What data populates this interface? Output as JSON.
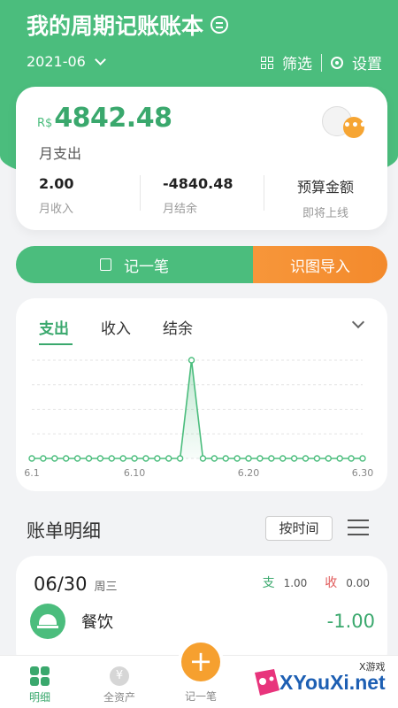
{
  "header": {
    "title": "我的周期记账账本",
    "month": "2021-06",
    "filter_label": "筛选",
    "settings_label": "设置"
  },
  "summary": {
    "currency": "R$",
    "amount": "4842.48",
    "amount_label": "月支出",
    "income_value": "2.00",
    "income_label": "月收入",
    "balance_value": "-4840.48",
    "balance_label": "月结余",
    "budget_value": "预算金额",
    "budget_label": "即将上线",
    "more_label": "•••"
  },
  "actions": {
    "record_label": "记一笔",
    "import_label": "识图导入"
  },
  "chart": {
    "tabs": [
      "支出",
      "收入",
      "结余"
    ],
    "active_tab": 0
  },
  "chart_data": {
    "type": "line",
    "x": [
      1,
      2,
      3,
      4,
      5,
      6,
      7,
      8,
      9,
      10,
      11,
      12,
      13,
      14,
      15,
      16,
      17,
      18,
      19,
      20,
      21,
      22,
      23,
      24,
      25,
      26,
      27,
      28,
      29,
      30
    ],
    "values": [
      0,
      0,
      0,
      0,
      0,
      0,
      0,
      0,
      0,
      0,
      0,
      0,
      0,
      0,
      4841.48,
      0,
      0,
      0,
      0,
      0,
      0,
      0,
      0,
      0,
      0,
      0,
      0,
      0,
      0,
      1
    ],
    "tick_labels": [
      "6.1",
      "6.10",
      "6.20",
      "6.30"
    ],
    "tick_positions": [
      1,
      10,
      20,
      30
    ],
    "grid": true,
    "color": "#4bbd7d"
  },
  "bills": {
    "section_title": "账单明细",
    "sort_label": "按时间",
    "day": {
      "date": "06/30",
      "weekday": "周三",
      "expense_key": "支",
      "expense_value": "1.00",
      "income_key": "收",
      "income_value": "0.00",
      "items": [
        {
          "category": "餐饮",
          "amount": "-1.00"
        }
      ]
    }
  },
  "tabbar": {
    "items": [
      {
        "label": "明细"
      },
      {
        "label": "全资产"
      },
      {
        "label": "记一笔"
      }
    ],
    "yen": "¥",
    "plus": "+"
  },
  "watermark": {
    "text": "XYouXi.net",
    "small": "X游戏"
  },
  "colors": {
    "primary": "#4bbd7d",
    "accent": "#f6a02f",
    "income_red": "#e05a5a"
  }
}
